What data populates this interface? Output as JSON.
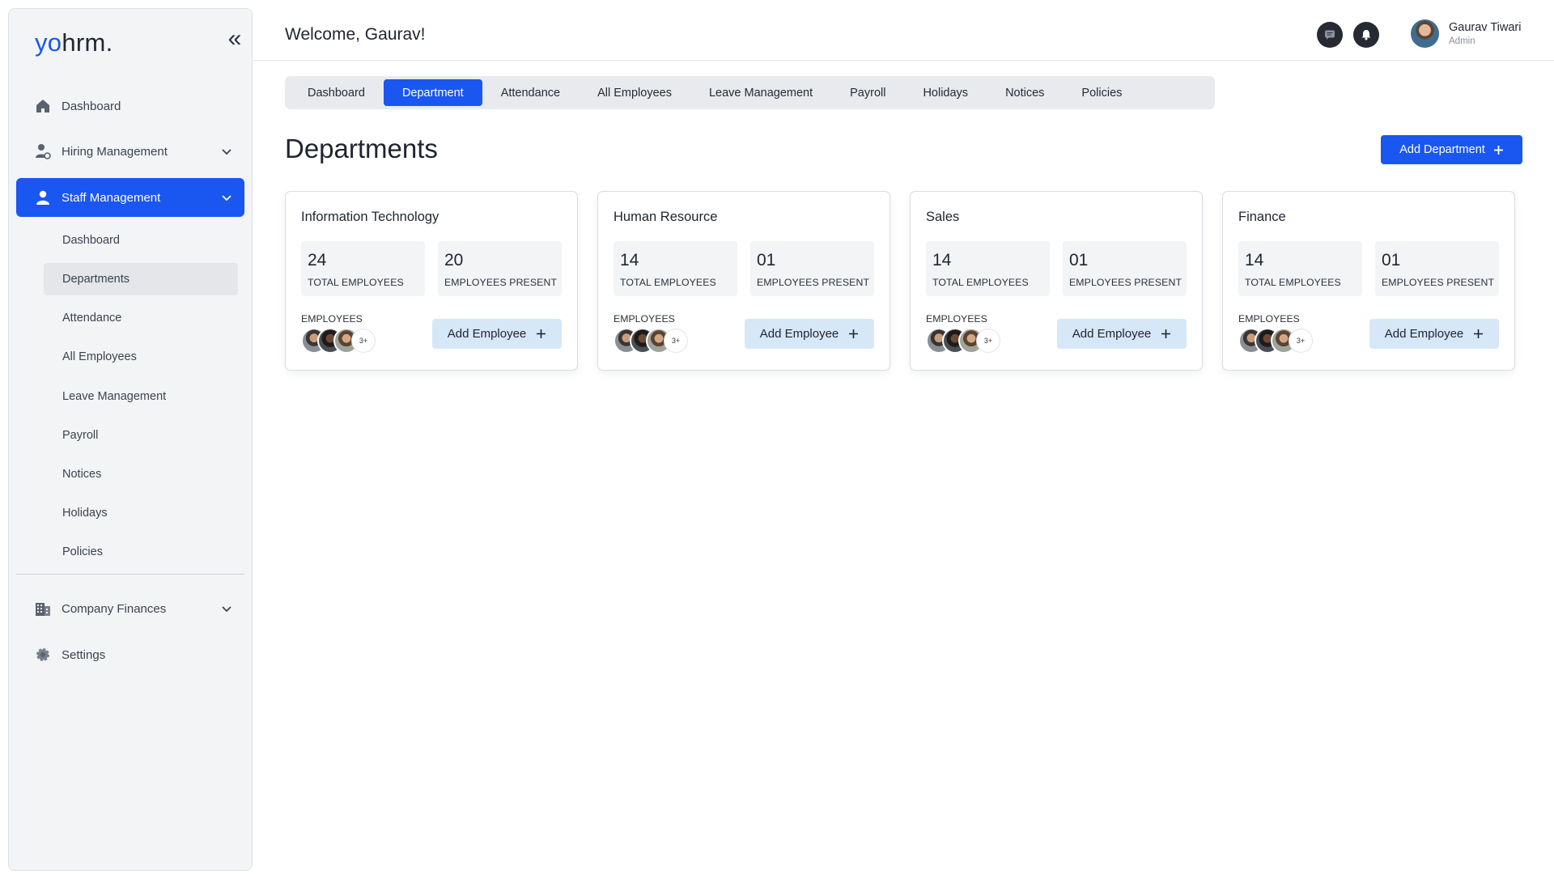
{
  "brand": {
    "logo_yo": "yo",
    "logo_rest": "hrm."
  },
  "sidebar": {
    "items": [
      {
        "label": "Dashboard"
      },
      {
        "label": "Hiring Management"
      },
      {
        "label": "Staff Management"
      },
      {
        "label": "Company Finances"
      },
      {
        "label": "Settings"
      }
    ],
    "staff_sub": [
      {
        "label": "Dashboard"
      },
      {
        "label": "Departments"
      },
      {
        "label": "Attendance"
      },
      {
        "label": "All Employees"
      },
      {
        "label": "Leave Management"
      },
      {
        "label": "Payroll"
      },
      {
        "label": "Notices"
      },
      {
        "label": "Holidays"
      },
      {
        "label": "Policies"
      }
    ]
  },
  "header": {
    "welcome": "Welcome,  Gaurav!",
    "user_name": "Gaurav Tiwari",
    "user_role": "Admin"
  },
  "tabs": [
    {
      "label": "Dashboard"
    },
    {
      "label": "Department"
    },
    {
      "label": "Attendance"
    },
    {
      "label": "All Employees"
    },
    {
      "label": "Leave Management"
    },
    {
      "label": "Payroll"
    },
    {
      "label": "Holidays"
    },
    {
      "label": "Notices"
    },
    {
      "label": "Policies"
    }
  ],
  "main": {
    "title": "Departments",
    "add_department": "Add Department",
    "departments": [
      {
        "name": "Information Technology",
        "total": "24",
        "total_label": "TOTAL EMPLOYEES",
        "present": "20",
        "present_label": "EMPLOYEES PRESENT",
        "employees_label": "EMPLOYEES",
        "more": "3+",
        "add_label": "Add Employee"
      },
      {
        "name": "Human Resource",
        "total": "14",
        "total_label": "TOTAL EMPLOYEES",
        "present": "01",
        "present_label": "EMPLOYEES PRESENT",
        "employees_label": "EMPLOYEES",
        "more": "3+",
        "add_label": "Add Employee"
      },
      {
        "name": "Sales",
        "total": "14",
        "total_label": "TOTAL EMPLOYEES",
        "present": "01",
        "present_label": "EMPLOYEES PRESENT",
        "employees_label": "EMPLOYEES",
        "more": "3+",
        "add_label": "Add Employee"
      },
      {
        "name": "Finance",
        "total": "14",
        "total_label": "TOTAL EMPLOYEES",
        "present": "01",
        "present_label": "EMPLOYEES PRESENT",
        "employees_label": "EMPLOYEES",
        "more": "3+",
        "add_label": "Add Employee"
      }
    ]
  },
  "colors": {
    "accent": "#1a56f0",
    "soft_button": "#d6e7f8",
    "sidebar_bg": "#f3f4f6"
  }
}
